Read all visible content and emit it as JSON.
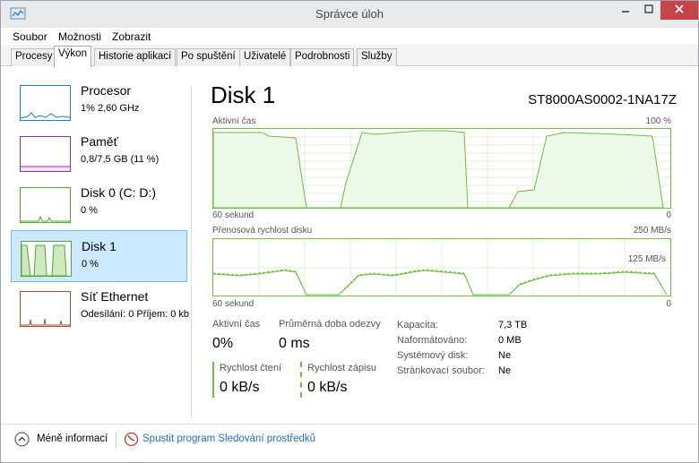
{
  "window": {
    "title": "Správce úloh"
  },
  "menu": [
    "Soubor",
    "Možnosti",
    "Zobrazit"
  ],
  "tabs": [
    "Procesy",
    "Výkon",
    "Historie aplikací",
    "Po spuštění",
    "Uživatelé",
    "Podrobnosti",
    "Služby"
  ],
  "resources": [
    {
      "title": "Procesor",
      "sub": "1% 2,60 GHz",
      "color": "#1b7fcf"
    },
    {
      "title": "Paměť",
      "sub": "0,8/7,5 GB (11 %)",
      "color": "#8b2fa8"
    },
    {
      "title": "Disk 0 (C: D:)",
      "sub": "0 %",
      "color": "#4ea72e"
    },
    {
      "title": "Disk 1",
      "sub": "0 %",
      "color": "#4ea72e",
      "selected": true
    },
    {
      "title": "Síť Ethernet",
      "sub": "Odesílání: 0 Příjem: 0 kb",
      "color": "#a0522d"
    }
  ],
  "detail": {
    "title": "Disk 1",
    "model": "ST8000AS0002-1NA17Z",
    "graph1": {
      "label": "Aktivní čas",
      "max": "100 %",
      "time": "60 sekund",
      "min": "0"
    },
    "graph2": {
      "label": "Přenosová rychlost disku",
      "max": "250 MB/s",
      "mid": "125 MB/s",
      "time": "60 sekund",
      "min": "0"
    },
    "stats": {
      "active_label": "Aktivní čas",
      "active_value": "0%",
      "resp_label": "Průměrná doba odezvy",
      "resp_value": "0 ms",
      "read_label": "Rychlost čtení",
      "read_value": "0 kB/s",
      "write_label": "Rychlost zápisu",
      "write_value": "0 kB/s"
    },
    "props": [
      {
        "k": "Kapacita:",
        "v": "7,3 TB"
      },
      {
        "k": "Naformátováno:",
        "v": "0 MB"
      },
      {
        "k": "Systémový disk:",
        "v": "Ne"
      },
      {
        "k": "Stránkovací soubor:",
        "v": "Ne"
      }
    ]
  },
  "footer": {
    "less": "Méně informací",
    "monitor": "Spustit program Sledování prostředků"
  },
  "colors": {
    "accent_green": "#6dbe3e",
    "selected_bg": "#cce8ff",
    "link": "#1e6fc2"
  }
}
